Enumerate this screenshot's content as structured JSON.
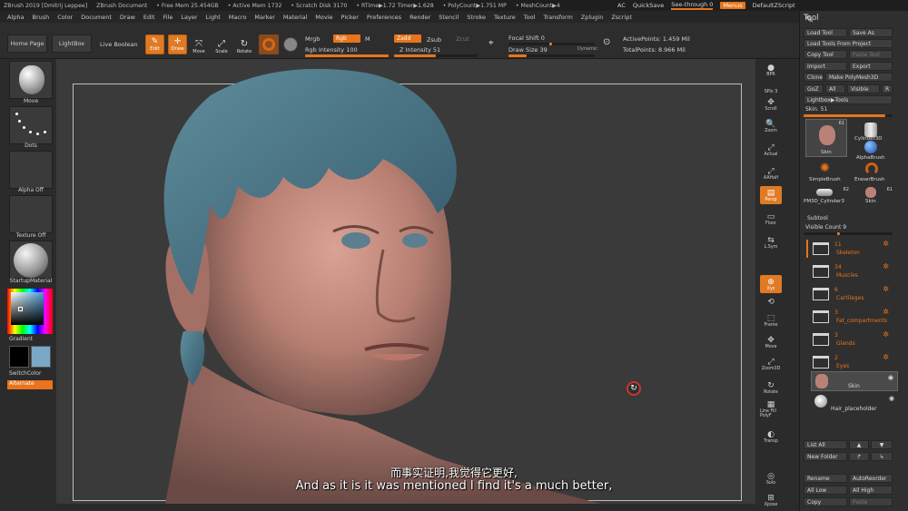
{
  "titlebar": {
    "app": "ZBrush 2019 [Dmitrij Leppee]",
    "doc": "ZBrush Document",
    "free_mem": "• Free Mem 25.454GB",
    "active_mem": "• Active Mem 1732",
    "scratch": "• Scratch Disk 3170",
    "rtime": "• RTime▶1.72 Timer▶1.628",
    "polycount": "• PolyCount▶1.751 MP",
    "meshcount": "• MeshCount▶4"
  },
  "topright": {
    "ac": "AC",
    "quicksave": "QuickSave",
    "seethrough": "See-through  0",
    "menus": "Menus",
    "script": "DefaultZScript"
  },
  "menu": [
    "Alpha",
    "Brush",
    "Color",
    "Document",
    "Draw",
    "Edit",
    "File",
    "Layer",
    "Light",
    "Macro",
    "Marker",
    "Material",
    "Movie",
    "Picker",
    "Preferences",
    "Render",
    "Stencil",
    "Stroke",
    "Texture",
    "Tool",
    "Transform",
    "Zplugin",
    "Zscript"
  ],
  "shelf": {
    "home_page": "Home Page",
    "lightbox": "LightBox",
    "live_boolean": "Live Boolean",
    "edit": "Edit",
    "draw": "Draw",
    "move": "Move",
    "scale": "Scale",
    "rotate": "Rotate",
    "mrgb": "Mrgb",
    "rgb": "Rgb",
    "m": "M",
    "zadd": "Zadd",
    "zsub": "Zsub",
    "zcut": "Zcut",
    "rgb_intensity": "Rgb Intensity 100",
    "z_intensity": "Z Intensity 51",
    "focal_shift": "Focal Shift 0",
    "draw_size": "Draw Size 39",
    "dynamic": "Dynamic",
    "active_points": "ActivePoints: 1.459 Mil",
    "total_points": "TotalPoints: 8.966 Mil"
  },
  "left": {
    "move": "Move",
    "dots": "Dots",
    "alpha_off": "Alpha Off",
    "texture_off": "Texture Off",
    "startup_material": "StartupMaterial",
    "gradient": "Gradient",
    "switch_color": "SwitchColor",
    "alternate": "Alternate"
  },
  "rightshelf": [
    "BPR",
    "SPix 3",
    "Scroll",
    "Zoom",
    "Actual",
    "AAHalf",
    "Persp",
    "Floor",
    "L.Sym",
    "",
    "Xyz",
    "",
    "Frame",
    "Move",
    "Zoom3D",
    "Rotate",
    "Line Fill PolyF",
    "Transp",
    "",
    "Solo",
    "Xpose"
  ],
  "panel": {
    "title": "Tool",
    "load_tool": "Load Tool",
    "save_as": "Save As",
    "load_from_project": "Load Tools From Project",
    "copy_tool": "Copy Tool",
    "paste_tool": "Paste Tool",
    "import": "Import",
    "export": "Export",
    "clone": "Clone",
    "make_polymesh": "Make PolyMesh3D",
    "goz": "GoZ",
    "all": "All",
    "visible": "Visible",
    "r": "R",
    "lightbox_tools": "Lightbox▶Tools",
    "skin_val": "Skin. 51",
    "thumb_count": "61",
    "thumbs": [
      "Skin",
      "Cylinder3D",
      "AlphaBrush",
      "SimpleBrush",
      "EraserBrush",
      "PM3D_Cylinder3",
      "Skin"
    ],
    "pm3d_count": "62",
    "skin2_count": "61",
    "subtool_title": "Subtool",
    "visible_count": "Visible Count 9",
    "subtools": [
      {
        "count": "11",
        "name": "Skeleton"
      },
      {
        "count": "34",
        "name": "Muscles"
      },
      {
        "count": "6",
        "name": "Cartilages"
      },
      {
        "count": "3",
        "name": "Fat_compartments"
      },
      {
        "count": "3",
        "name": "Glands"
      },
      {
        "count": "2",
        "name": "Eyes"
      }
    ],
    "skin_row": "Skin",
    "hair_row": "Hair_placeholder",
    "list_all": "List All",
    "new_folder": "New Folder",
    "rename": "Rename",
    "autoreorder": "AutoReorder",
    "all_low": "All Low",
    "all_high": "All High",
    "copy": "Copy",
    "paste": "Paste"
  },
  "subtitles": {
    "chinese": "而事实证明,我觉得它更好,",
    "english": "And as it is it was mentioned I find it's a much better,"
  },
  "colors": {
    "accent": "#e8741c",
    "hair": "#4f7a8a",
    "skin": "#c98c7c"
  }
}
